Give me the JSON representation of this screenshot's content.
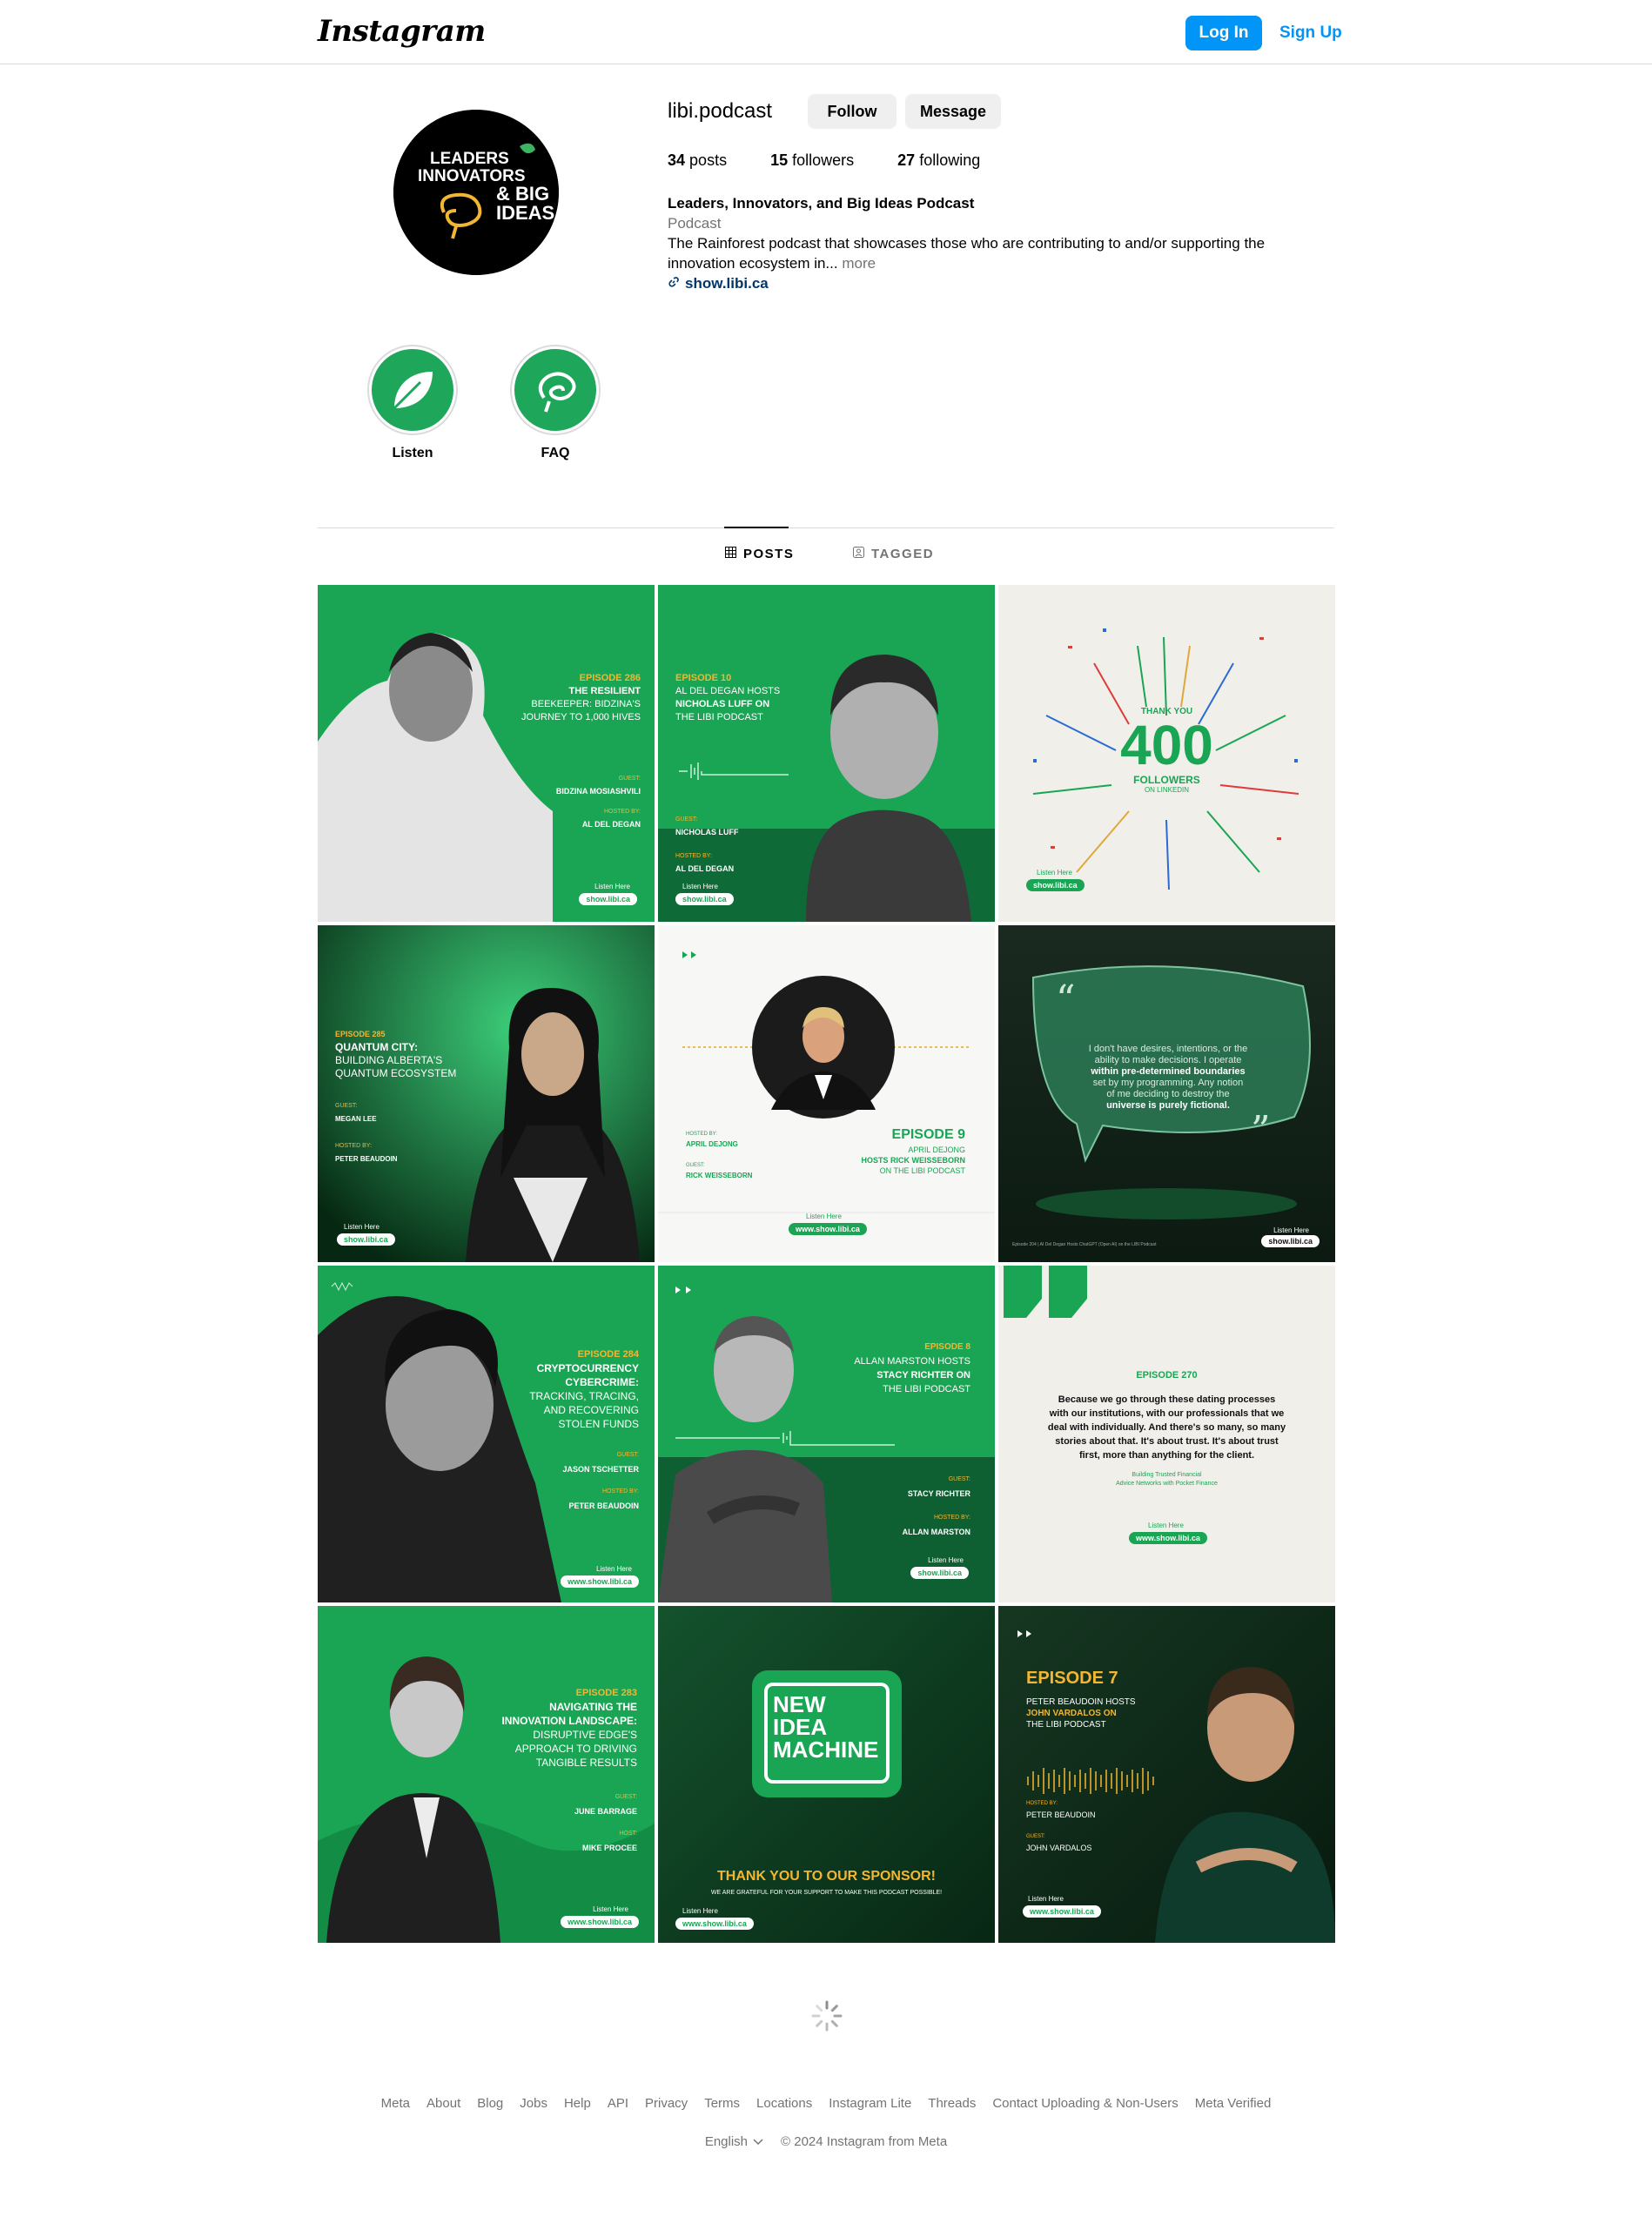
{
  "nav": {
    "logo": "Instagram",
    "login": "Log In",
    "signup": "Sign Up"
  },
  "profile": {
    "username": "libi.podcast",
    "follow": "Follow",
    "message": "Message",
    "posts": "34",
    "posts_label": "posts",
    "followers": "15",
    "followers_label": "followers",
    "following": "27",
    "following_label": "following",
    "full_name": "Leaders, Innovators, and Big Ideas Podcast",
    "category": "Podcast",
    "bio": "The Rainforest podcast that showcases those who are contributing to and/or supporting the innovation ecosystem in...",
    "more": "more",
    "link": "show.libi.ca",
    "avatar_text": [
      "LEADERS",
      "INNOVATORS",
      "& BIG",
      "IDEAS"
    ]
  },
  "highlights": [
    {
      "label": "Listen",
      "icon": "leaf-icon"
    },
    {
      "label": "FAQ",
      "icon": "brain-icon"
    }
  ],
  "tabs": {
    "posts": "POSTS",
    "tagged": "TAGGED"
  },
  "posts": [
    {
      "type": "episode-green",
      "ep": "EPISODE 286",
      "title1": "THE RESILIENT",
      "title2": "BEEKEEPER: BIDZINA'S",
      "title3": "JOURNEY TO 1,000 HIVES",
      "guest_label": "GUEST:",
      "guest": "BIDZINA MOSIASHVILI",
      "host_label": "HOSTED BY:",
      "host": "AL DEL DEGAN",
      "listen": "Listen Here",
      "url": "show.libi.ca"
    },
    {
      "type": "episode-green-host",
      "ep": "EPISODE 10",
      "title1": "AL DEL DEGAN HOSTS",
      "title2": "NICHOLAS LUFF ON",
      "title3": "THE LIBI PODCAST",
      "guest_label": "GUEST:",
      "guest": "NICHOLAS LUFF",
      "host_label": "HOSTED BY:",
      "host": "AL DEL DEGAN",
      "listen": "Listen Here",
      "url": "show.libi.ca"
    },
    {
      "type": "followers",
      "thanks": "THANK YOU",
      "count": "400",
      "label": "FOLLOWERS",
      "sub": "ON LINKEDIN",
      "listen": "Listen Here",
      "url": "show.libi.ca"
    },
    {
      "type": "episode-dark",
      "ep": "EPISODE 285",
      "title1": "QUANTUM CITY:",
      "title2": "BUILDING ALBERTA'S",
      "title3": "QUANTUM ECOSYSTEM",
      "guest_label": "GUEST:",
      "guest": "MEGAN LEE",
      "host_label": "HOSTED BY:",
      "host": "PETER BEAUDOIN",
      "listen": "Listen Here",
      "url": "show.libi.ca"
    },
    {
      "type": "episode-white",
      "ep": "EPISODE 9",
      "title1": "APRIL DEJONG",
      "title2": "HOSTS RICK WEISSEBORN",
      "title3": "ON THE LIBI PODCAST",
      "host_label": "HOSTED BY:",
      "host": "APRIL DEJONG",
      "guest_label": "GUEST:",
      "guest": "RICK WEISSEBORN",
      "listen": "Listen Here",
      "url": "www.show.libi.ca"
    },
    {
      "type": "quote-dark",
      "q1": "I don't have desires, intentions, or the",
      "q2": "ability to make decisions. I operate",
      "q3": "within pre-determined boundaries",
      "q4": "set by my programming. Any notion",
      "q5": "of me deciding to destroy the",
      "q6": "universe is purely fictional.",
      "foot": "Episode 204 | AI Del Degan Hosts ChatGPT (Open AI) on the LIBI Podcast",
      "listen": "Listen Here",
      "url": "show.libi.ca"
    },
    {
      "type": "episode-bw",
      "ep": "EPISODE 284",
      "title1": "CRYPTOCURRENCY",
      "title2": "CYBERCRIME:",
      "title3": "TRACKING, TRACING,",
      "title4": "AND RECOVERING",
      "title5": "STOLEN FUNDS",
      "guest_label": "GUEST:",
      "guest": "JASON TSCHETTER",
      "host_label": "HOSTED BY:",
      "host": "PETER BEAUDOIN",
      "listen": "Listen Here",
      "url": "www.show.libi.ca"
    },
    {
      "type": "episode-green-host2",
      "ep": "EPISODE 8",
      "title1": "ALLAN MARSTON HOSTS",
      "title2": "STACY RICHTER ON",
      "title3": "THE LIBI PODCAST",
      "guest_label": "GUEST:",
      "guest": "STACY RICHTER",
      "host_label": "HOSTED BY:",
      "host": "ALLAN MARSTON",
      "listen": "Listen Here",
      "url": "show.libi.ca"
    },
    {
      "type": "quote-cream",
      "ep": "EPISODE 270",
      "q1": "Because we go through these dating processes",
      "q2": "with our institutions, with our professionals that we",
      "q3": "deal with individually. And there's so many, so many",
      "q4": "stories about that. It's about trust. It's about trust",
      "q5": "first, more than anything for the client.",
      "s1": "Building Trusted Financial",
      "s2": "Advice Networks with Pocket Finance",
      "listen": "Listen Here",
      "url": "www.show.libi.ca"
    },
    {
      "type": "episode-green-woman",
      "ep": "EPISODE 283",
      "title1": "NAVIGATING THE",
      "title2": "INNOVATION LANDSCAPE:",
      "title3": "DISRUPTIVE EDGE'S",
      "title4": "APPROACH TO DRIVING",
      "title5": "TANGIBLE RESULTS",
      "guest_label": "GUEST:",
      "guest": "JUNE BARRAGE",
      "host_label": "HOST:",
      "host": "MIKE PROCEE",
      "listen": "Listen Here",
      "url": "www.show.libi.ca"
    },
    {
      "type": "sponsor",
      "b1": "NEW",
      "b2": "IDEA",
      "b3": "MACHINE",
      "thanks": "THANK YOU TO OUR SPONSOR!",
      "sub": "WE ARE GRATEFUL FOR YOUR SUPPORT TO MAKE THIS PODCAST POSSIBLE!",
      "listen": "Listen Here",
      "url": "www.show.libi.ca"
    },
    {
      "type": "episode-dark-gold",
      "ep": "EPISODE 7",
      "title1": "PETER BEAUDOIN HOSTS",
      "title2": "JOHN VARDALOS ON",
      "title3": "THE LIBI PODCAST",
      "host_label": "HOSTED BY:",
      "host": "PETER BEAUDOIN",
      "guest_label": "GUEST:",
      "guest": "JOHN VARDALOS",
      "listen": "Listen Here",
      "url": "www.show.libi.ca"
    }
  ],
  "footer": {
    "links": [
      "Meta",
      "About",
      "Blog",
      "Jobs",
      "Help",
      "API",
      "Privacy",
      "Terms",
      "Locations",
      "Instagram Lite",
      "Threads",
      "Contact Uploading & Non-Users",
      "Meta Verified"
    ],
    "language": "English",
    "copyright": "© 2024 Instagram from Meta"
  },
  "colors": {
    "brand_blue": "#0095f6",
    "libi_green": "#1aa554",
    "gold": "#f2b632"
  }
}
